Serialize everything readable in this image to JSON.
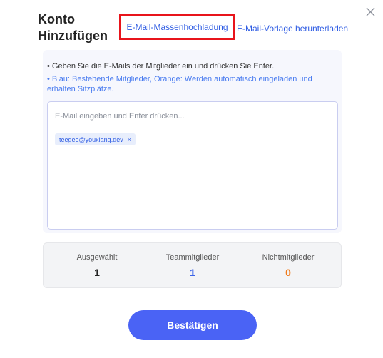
{
  "dialog": {
    "title": "Konto Hinzufügen",
    "close_icon": "close-icon",
    "bulk_upload_link": "E-Mail-Massenhochladung",
    "template_download_link": "E-Mail-Vorlage herunterladen"
  },
  "instructions": {
    "line1": "• Geben Sie die E-Mails der Mitglieder ein und drücken Sie Enter.",
    "line2": "• Blau: Bestehende Mitglieder, Orange: Werden automatisch eingeladen und erhalten Sitzplätze."
  },
  "email_input": {
    "value": "",
    "placeholder": "E-Mail eingeben und Enter drücken..."
  },
  "email_tags": [
    {
      "email": "teegee@youxiang.dev",
      "remove": "×",
      "color": "#2d5be3"
    }
  ],
  "stats": [
    {
      "label": "Ausgewählt",
      "value": "1",
      "color": "#222222"
    },
    {
      "label": "Teammitglieder",
      "value": "1",
      "color": "#3a63e8"
    },
    {
      "label": "Nichtmitglieder",
      "value": "0",
      "color": "#f07a1a"
    }
  ],
  "confirm_button": {
    "label": "Bestätigen",
    "color": "#4a63f5"
  },
  "colors": {
    "accent": "#2d5be3",
    "highlight_border": "#e8141b",
    "member_blue": "#3a63e8",
    "nonmember_orange": "#f07a1a"
  }
}
